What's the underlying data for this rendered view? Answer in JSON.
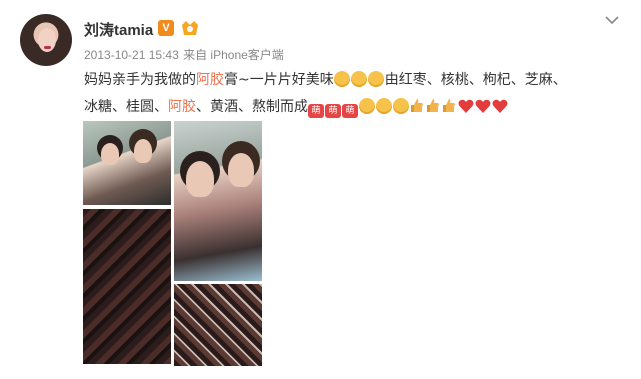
{
  "post": {
    "username": "刘涛tamia",
    "verified_mark": "V",
    "timestamp": "2013-10-21 15:43",
    "source": "来自 iPhone客户端",
    "text_segments": {
      "s1": "妈妈亲手为我做的",
      "s2": "阿胶",
      "s3": "膏~一片片好美味",
      "s4": "由红枣、核桃、枸杞、芝麻、",
      "s5": "冰糖、桂圆、",
      "s6": "阿胶",
      "s7": "、黄酒、熬制而成",
      "sticker": "萌"
    },
    "icons": {
      "avatar": "profile-photo",
      "verified": "verified-badge-icon",
      "member": "vip-member-icon",
      "menu": "chevron-down-icon"
    },
    "photos_count": 4,
    "colors": {
      "highlight": "#eb7350",
      "badge": "#f18b1d",
      "heart": "#e23c3c"
    }
  }
}
